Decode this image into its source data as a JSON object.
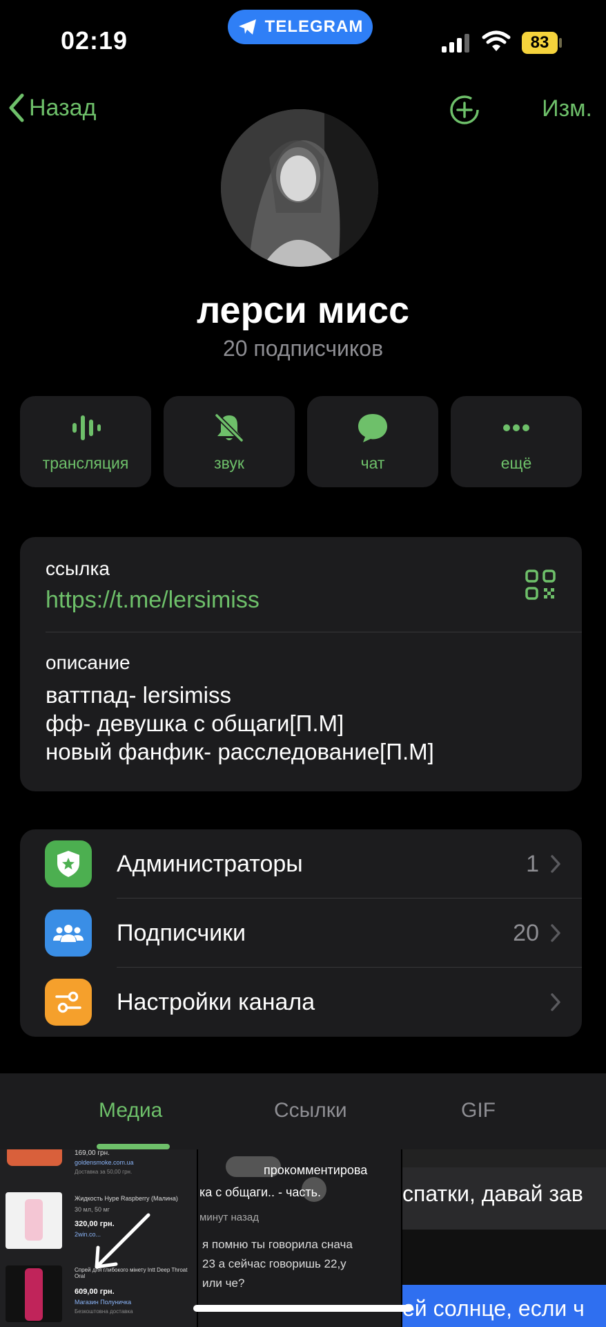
{
  "status_bar": {
    "time": "02:19",
    "app_pill": "TELEGRAM",
    "battery": "83"
  },
  "nav": {
    "back_label": "Назад",
    "edit_label": "Изм."
  },
  "channel": {
    "name": "лерси мисс",
    "subscribers": "20 подписчиков"
  },
  "actions": [
    {
      "label": "трансляция",
      "icon": "broadcast-icon"
    },
    {
      "label": "звук",
      "icon": "bell-off-icon"
    },
    {
      "label": "чат",
      "icon": "chat-bubble-icon"
    },
    {
      "label": "ещё",
      "icon": "more-icon"
    }
  ],
  "info": {
    "link_label": "ссылка",
    "link_value": "https://t.me/lersimiss",
    "description_label": "описание",
    "description_lines": [
      "ваттпад- lersimiss",
      "фф- девушка с общаги[П.М]",
      "новый фанфик- расследование[П.М]"
    ]
  },
  "menu": [
    {
      "label": "Администраторы",
      "count": "1",
      "icon": "shield-star-icon",
      "color": "#4caf50"
    },
    {
      "label": "Подписчики",
      "count": "20",
      "icon": "people-icon",
      "color": "#3a8ee6"
    },
    {
      "label": "Настройки канала",
      "count": "",
      "icon": "sliders-icon",
      "color": "#f5a02c"
    }
  ],
  "tabs": [
    {
      "label": "Медиа",
      "active": true
    },
    {
      "label": "Ссылки",
      "active": false
    },
    {
      "label": "GIF",
      "active": false
    }
  ],
  "media": {
    "item1": {
      "rows": [
        {
          "price": "169,00 грн.",
          "shop": "goldensmoke.com.ua",
          "note": "Доставка за 50,00 грн."
        },
        {
          "title": "Жидкость Hype Raspberry (Малина)",
          "size": "30 мл, 50 мг",
          "price": "320,00 грн.",
          "shop": "2win.co..."
        },
        {
          "title": "Спрей для глибокого мінету Intt Deep Throat Oral",
          "price": "609,00 грн.",
          "shop": "Магазин Полуничка",
          "note": "Безкоштовна доставка"
        }
      ]
    },
    "item2": {
      "lines": [
        "прокомментирова",
        "ка с общаги.. - часть.",
        "минут назад",
        "я помню ты говорила снача",
        "23 а сейчас говоришь 22,у",
        "или че?"
      ]
    },
    "item3": {
      "line_top": "спатки, давай зав",
      "line_bottom": "ей солнце, если ч"
    }
  },
  "colors": {
    "accent": "#6ec06a",
    "card": "#1c1c1e",
    "secondary_text": "#8e8e93"
  }
}
